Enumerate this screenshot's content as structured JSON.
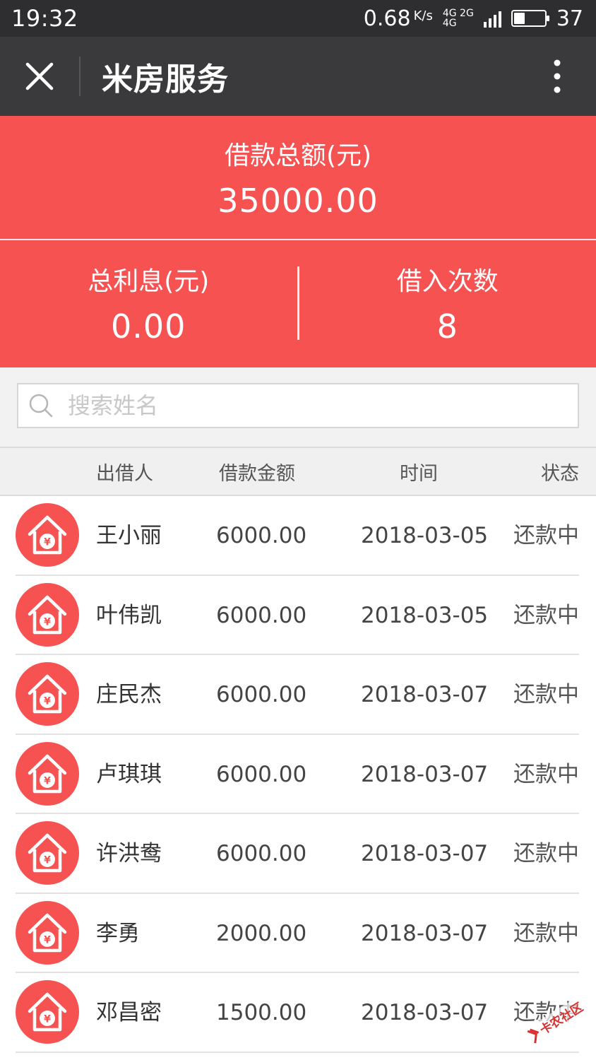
{
  "status_bar": {
    "time": "19:32",
    "speed": "0.68",
    "speed_unit": "K/s",
    "network_top": "4G 2G",
    "network_bottom": "4G",
    "battery_level": "37",
    "battery_fill_fraction": 0.37
  },
  "nav": {
    "title": "米房服务",
    "close_icon": "close-icon",
    "more_icon": "more-vertical-icon"
  },
  "summary": {
    "total_label": "借款总额(元)",
    "total_value": "35000.00",
    "interest_label": "总利息(元)",
    "interest_value": "0.00",
    "count_label": "借入次数",
    "count_value": "8"
  },
  "search": {
    "placeholder": "搜索姓名",
    "value": ""
  },
  "table": {
    "headers": {
      "lender": "出借人",
      "amount": "借款金额",
      "time": "时间",
      "status": "状态"
    },
    "rows": [
      {
        "name": "王小丽",
        "amount": "6000.00",
        "date": "2018-03-05",
        "status": "还款中"
      },
      {
        "name": "叶伟凯",
        "amount": "6000.00",
        "date": "2018-03-05",
        "status": "还款中"
      },
      {
        "name": "庄民杰",
        "amount": "6000.00",
        "date": "2018-03-07",
        "status": "还款中"
      },
      {
        "name": "卢琪琪",
        "amount": "6000.00",
        "date": "2018-03-07",
        "status": "还款中"
      },
      {
        "name": "许洪鸯",
        "amount": "6000.00",
        "date": "2018-03-07",
        "status": "还款中"
      },
      {
        "name": "李勇",
        "amount": "2000.00",
        "date": "2018-03-07",
        "status": "还款中"
      },
      {
        "name": "邓昌密",
        "amount": "1500.00",
        "date": "2018-03-07",
        "status": "还款中"
      }
    ]
  },
  "watermark": {
    "text": "卡农社区"
  },
  "colors": {
    "accent": "#f75252",
    "nav_bg": "#3a3a3c",
    "status_bg": "#2e2e30"
  }
}
